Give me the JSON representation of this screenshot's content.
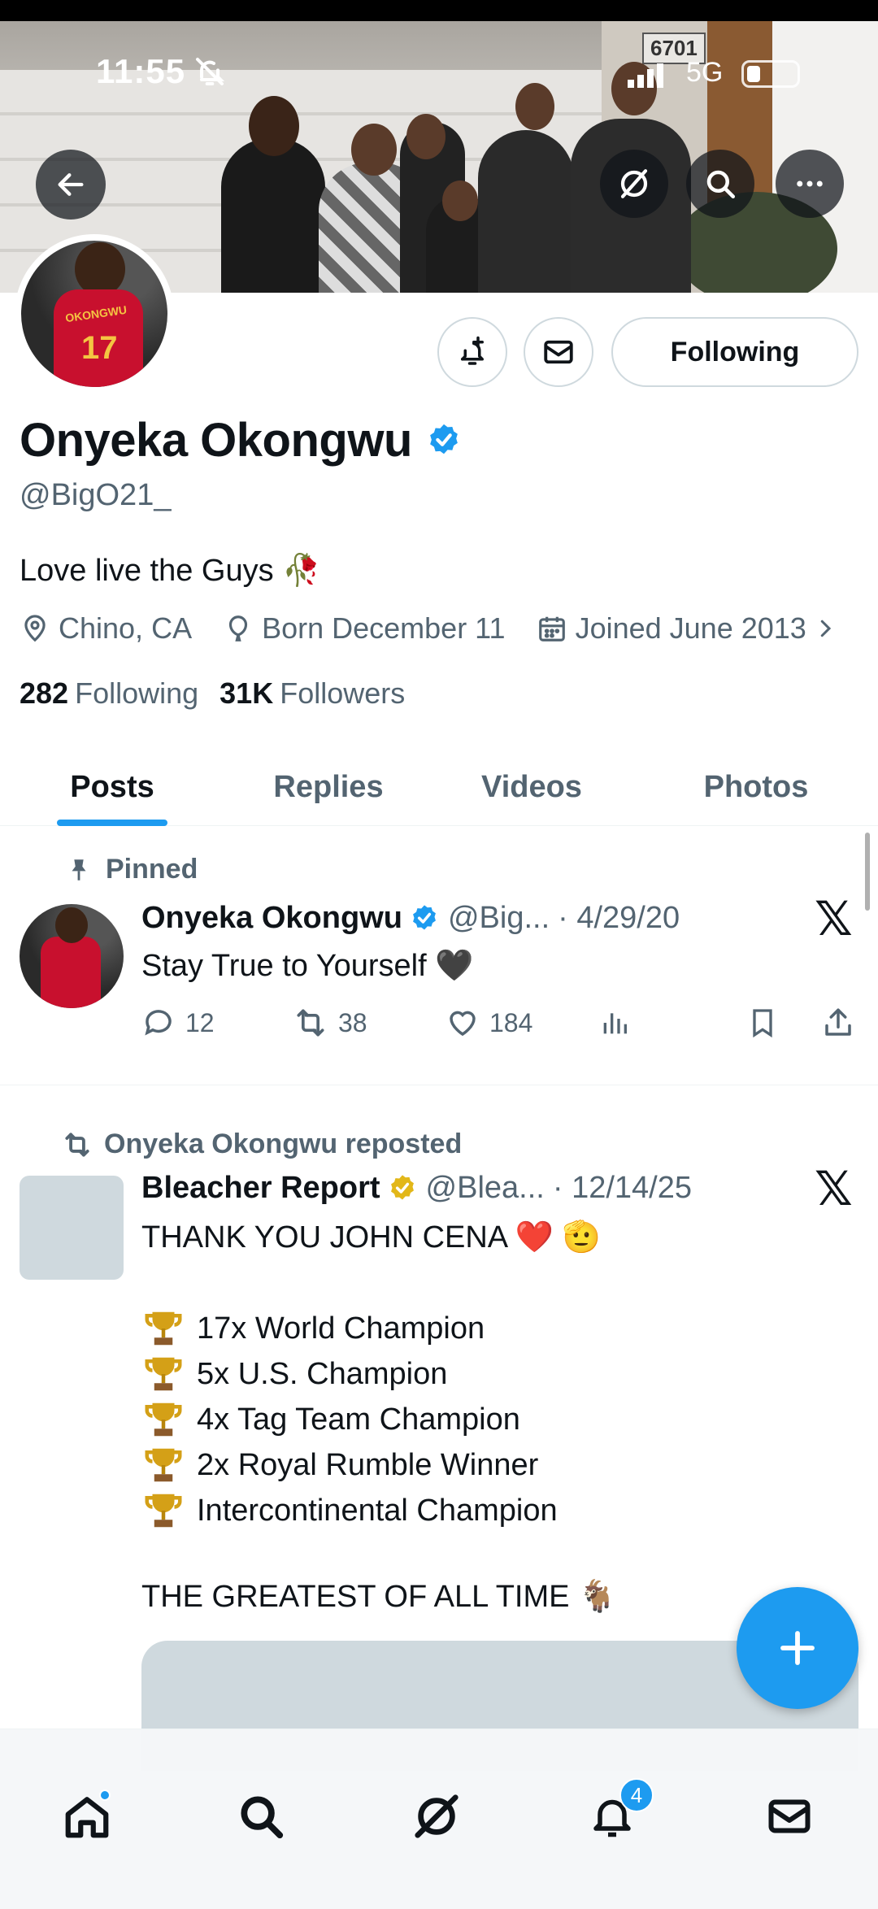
{
  "status_bar": {
    "time": "11:55",
    "network": "5G"
  },
  "banner": {
    "address": "6701"
  },
  "profile": {
    "name": "Onyeka Okongwu",
    "handle": "@BigO21_",
    "bio": "Love live the Guys 🥀",
    "location": "Chino, CA",
    "born": "Born December 11",
    "joined": "Joined June 2013",
    "following_count": "282",
    "following_label": "Following",
    "followers_count": "31K",
    "followers_label": "Followers",
    "follow_button": "Following",
    "avatar_jersey_name": "OKONGWU",
    "avatar_jersey_number": "17"
  },
  "tabs": [
    {
      "label": "Posts",
      "active": true
    },
    {
      "label": "Replies"
    },
    {
      "label": "Videos"
    },
    {
      "label": "Photos"
    }
  ],
  "posts": [
    {
      "context": "Pinned",
      "author": "Onyeka Okongwu",
      "handle": "@Big...",
      "date": "· 4/29/20",
      "text": "Stay True to Yourself 🖤",
      "replies": "12",
      "reposts": "38",
      "likes": "184"
    },
    {
      "context": "Onyeka Okongwu reposted",
      "author": "Bleacher Report",
      "handle": "@Blea...",
      "date": "· 12/14/25",
      "text_line1": "THANK YOU JOHN CENA ❤️ 🫡",
      "list": [
        "17x World Champion",
        "5x U.S. Champion",
        "4x Tag Team Champion",
        "2x Royal Rumble Winner",
        "Intercontinental Champion"
      ],
      "text_last": "THE GREATEST OF ALL TIME 🐐"
    }
  ],
  "bottom_nav": {
    "notifications_badge": "4"
  },
  "colors": {
    "accent": "#1d9bf0",
    "muted": "#536471",
    "verified_blue": "#1d9bf0",
    "verified_gold": "#e2b719"
  }
}
